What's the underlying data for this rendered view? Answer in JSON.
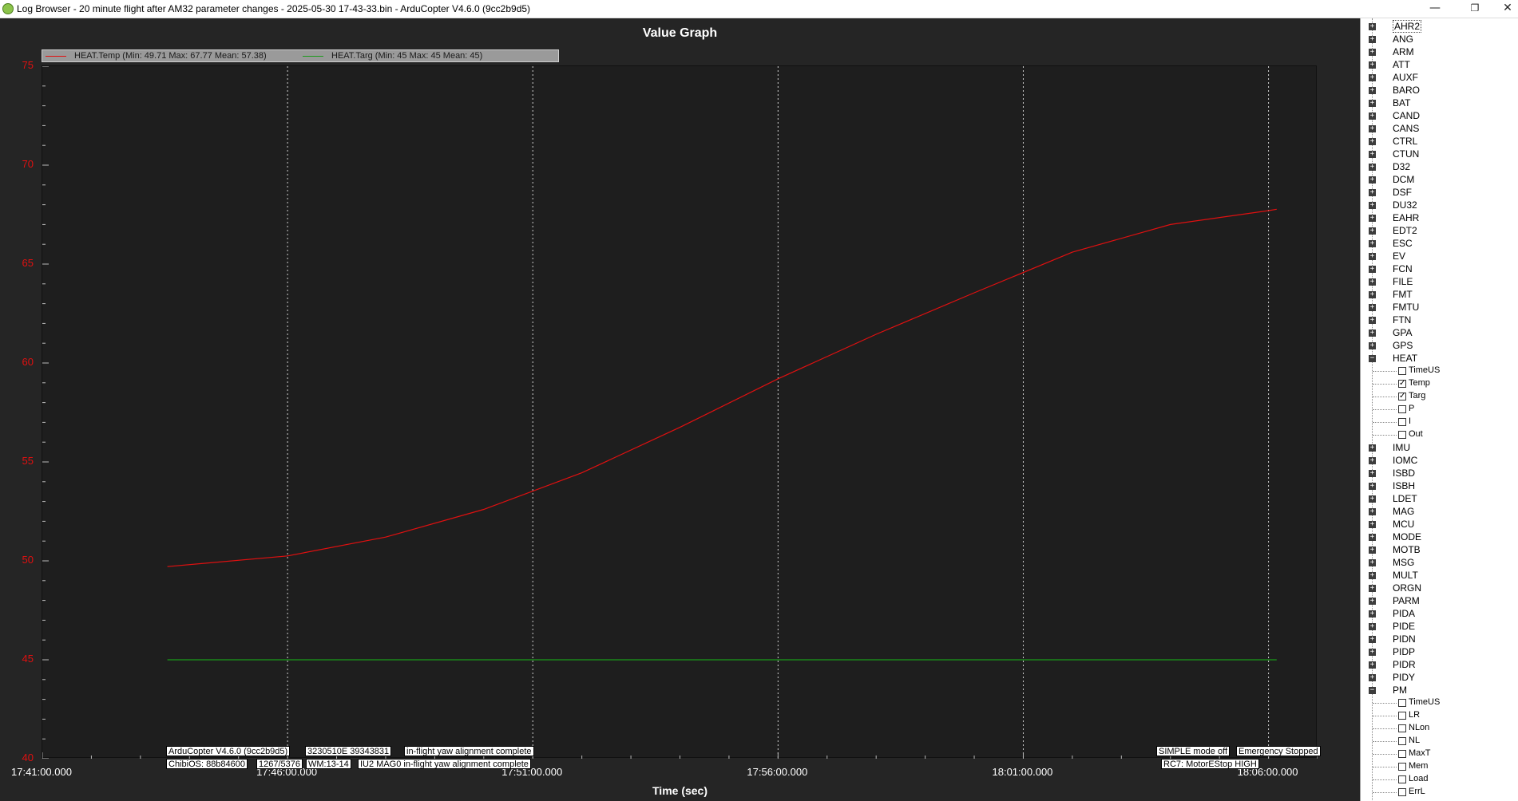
{
  "window": {
    "title": "Log Browser - 20 minute flight after AM32 parameter changes - 2025-05-30 17-43-33.bin - ArduCopter V4.6.0 (9cc2b9d5)",
    "minimize": "—",
    "restore": "❐",
    "close": "✕"
  },
  "graph": {
    "title": "Value Graph",
    "xlabel": "Time (sec)",
    "legend": [
      {
        "label": "HEAT.Temp  (Min: 49.71 Max: 67.77 Mean: 57.38)",
        "color": "#e01010"
      },
      {
        "label": "HEAT.Targ  (Min: 45 Max: 45 Mean: 45)",
        "color": "#1a9a1a"
      }
    ]
  },
  "annotations": {
    "left_row1": [
      "ArduCopter V4.6.0 (9cc2b9d5)",
      "3230510E 39343831",
      "in-flight yaw alignment complete"
    ],
    "left_row2": [
      "ChibiOS: 88b84600",
      "1267/5376",
      "WM:13-14",
      "IU2 MAG0 in-flight yaw alignment complete"
    ],
    "right_row1": [
      "SIMPLE mode off",
      "Emergency Stopped"
    ],
    "right_row2": [
      "RC7: MotorEStop HIGH"
    ]
  },
  "chart_data": {
    "type": "line",
    "title": "Value Graph",
    "xlabel": "Time (sec)",
    "ylabel": "",
    "xlim": [
      "17:41:00.000",
      "18:07:00.000"
    ],
    "ylim": [
      40,
      75
    ],
    "x_ticks": [
      "17:41:00.000",
      "17:46:00.000",
      "17:51:00.000",
      "17:56:00.000",
      "18:01:00.000",
      "18:06:00.000"
    ],
    "y_ticks": [
      40,
      45,
      50,
      55,
      60,
      65,
      70,
      75
    ],
    "grid": "vertical dotted",
    "legend": "top-left",
    "x": [
      "17:43:33",
      "17:46:00",
      "17:48:00",
      "17:50:00",
      "17:52:00",
      "17:54:00",
      "17:56:00",
      "17:58:00",
      "18:00:00",
      "18:02:00",
      "18:04:00",
      "18:06:00",
      "18:06:10"
    ],
    "series": [
      {
        "name": "HEAT.Temp",
        "values": [
          49.71,
          50.25,
          51.2,
          52.6,
          54.45,
          56.75,
          59.2,
          61.45,
          63.55,
          65.6,
          67.0,
          67.7,
          67.77
        ]
      },
      {
        "name": "HEAT.Targ",
        "values": [
          45,
          45,
          45,
          45,
          45,
          45,
          45,
          45,
          45,
          45,
          45,
          45,
          45
        ]
      }
    ]
  },
  "tree": {
    "items": [
      {
        "label": "AHR2",
        "type": "group",
        "expander": "+"
      },
      {
        "label": "ANG",
        "type": "group",
        "expander": "+"
      },
      {
        "label": "ARM",
        "type": "group",
        "expander": "+"
      },
      {
        "label": "ATT",
        "type": "group",
        "expander": "+"
      },
      {
        "label": "AUXF",
        "type": "group",
        "expander": "+"
      },
      {
        "label": "BARO",
        "type": "group",
        "expander": "+"
      },
      {
        "label": "BAT",
        "type": "group",
        "expander": "+"
      },
      {
        "label": "CAND",
        "type": "group",
        "expander": "+"
      },
      {
        "label": "CANS",
        "type": "group",
        "expander": "+"
      },
      {
        "label": "CTRL",
        "type": "group",
        "expander": "+"
      },
      {
        "label": "CTUN",
        "type": "group",
        "expander": "+"
      },
      {
        "label": "D32",
        "type": "group",
        "expander": "+"
      },
      {
        "label": "DCM",
        "type": "group",
        "expander": "+"
      },
      {
        "label": "DSF",
        "type": "group",
        "expander": "+"
      },
      {
        "label": "DU32",
        "type": "group",
        "expander": "+"
      },
      {
        "label": "EAHR",
        "type": "group",
        "expander": "+"
      },
      {
        "label": "EDT2",
        "type": "group",
        "expander": "+"
      },
      {
        "label": "ESC",
        "type": "group",
        "expander": "+"
      },
      {
        "label": "EV",
        "type": "group",
        "expander": "+"
      },
      {
        "label": "FCN",
        "type": "group",
        "expander": "+"
      },
      {
        "label": "FILE",
        "type": "group",
        "expander": "+"
      },
      {
        "label": "FMT",
        "type": "group",
        "expander": "+"
      },
      {
        "label": "FMTU",
        "type": "group",
        "expander": "+"
      },
      {
        "label": "FTN",
        "type": "group",
        "expander": "+"
      },
      {
        "label": "GPA",
        "type": "group",
        "expander": "+"
      },
      {
        "label": "GPS",
        "type": "group",
        "expander": "+"
      },
      {
        "label": "HEAT",
        "type": "group",
        "expander": "−"
      },
      {
        "label": "TimeUS",
        "type": "field",
        "checked": ""
      },
      {
        "label": "Temp",
        "type": "field",
        "checked": "✓"
      },
      {
        "label": "Targ",
        "type": "field",
        "checked": "✓"
      },
      {
        "label": "P",
        "type": "field",
        "checked": ""
      },
      {
        "label": "I",
        "type": "field",
        "checked": ""
      },
      {
        "label": "Out",
        "type": "field",
        "checked": ""
      },
      {
        "label": "IMU",
        "type": "group",
        "expander": "+"
      },
      {
        "label": "IOMC",
        "type": "group",
        "expander": "+"
      },
      {
        "label": "ISBD",
        "type": "group",
        "expander": "+"
      },
      {
        "label": "ISBH",
        "type": "group",
        "expander": "+"
      },
      {
        "label": "LDET",
        "type": "group",
        "expander": "+"
      },
      {
        "label": "MAG",
        "type": "group",
        "expander": "+"
      },
      {
        "label": "MCU",
        "type": "group",
        "expander": "+"
      },
      {
        "label": "MODE",
        "type": "group",
        "expander": "+"
      },
      {
        "label": "MOTB",
        "type": "group",
        "expander": "+"
      },
      {
        "label": "MSG",
        "type": "group",
        "expander": "+"
      },
      {
        "label": "MULT",
        "type": "group",
        "expander": "+"
      },
      {
        "label": "ORGN",
        "type": "group",
        "expander": "+"
      },
      {
        "label": "PARM",
        "type": "group",
        "expander": "+"
      },
      {
        "label": "PIDA",
        "type": "group",
        "expander": "+"
      },
      {
        "label": "PIDE",
        "type": "group",
        "expander": "+"
      },
      {
        "label": "PIDN",
        "type": "group",
        "expander": "+"
      },
      {
        "label": "PIDP",
        "type": "group",
        "expander": "+"
      },
      {
        "label": "PIDR",
        "type": "group",
        "expander": "+"
      },
      {
        "label": "PIDY",
        "type": "group",
        "expander": "+"
      },
      {
        "label": "PM",
        "type": "group",
        "expander": "−"
      },
      {
        "label": "TimeUS",
        "type": "field",
        "checked": ""
      },
      {
        "label": "LR",
        "type": "field",
        "checked": ""
      },
      {
        "label": "NLon",
        "type": "field",
        "checked": ""
      },
      {
        "label": "NL",
        "type": "field",
        "checked": ""
      },
      {
        "label": "MaxT",
        "type": "field",
        "checked": ""
      },
      {
        "label": "Mem",
        "type": "field",
        "checked": ""
      },
      {
        "label": "Load",
        "type": "field",
        "checked": ""
      },
      {
        "label": "ErrL",
        "type": "field",
        "checked": ""
      }
    ]
  }
}
